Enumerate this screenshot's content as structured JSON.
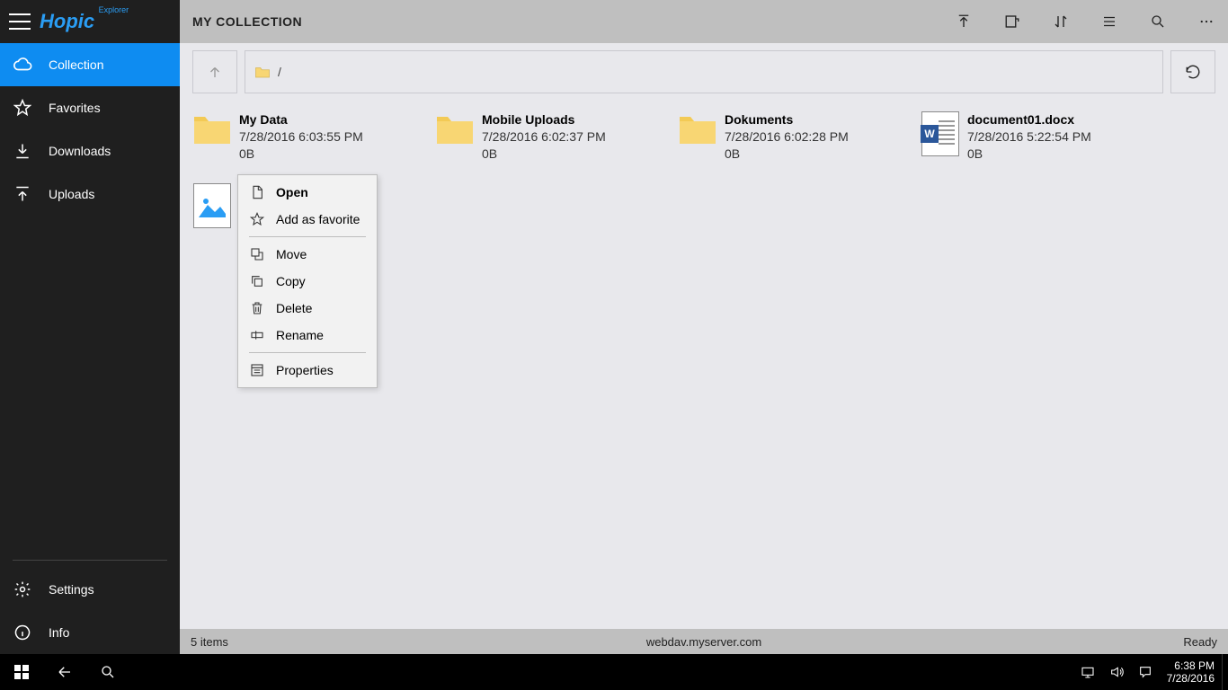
{
  "brand": {
    "name": "Hopic",
    "tag": "Explorer"
  },
  "sidebar": {
    "items": [
      {
        "label": "Collection"
      },
      {
        "label": "Favorites"
      },
      {
        "label": "Downloads"
      },
      {
        "label": "Uploads"
      }
    ],
    "footer": [
      {
        "label": "Settings"
      },
      {
        "label": "Info"
      }
    ]
  },
  "topbar": {
    "title": "MY COLLECTION"
  },
  "pathbar": {
    "path": "/"
  },
  "items": [
    {
      "name": "My Data",
      "date": "7/28/2016 6:03:55 PM",
      "size": "0B",
      "kind": "folder"
    },
    {
      "name": "Mobile Uploads",
      "date": "7/28/2016 6:02:37 PM",
      "size": "0B",
      "kind": "folder"
    },
    {
      "name": "Dokuments",
      "date": "7/28/2016 6:02:28 PM",
      "size": "0B",
      "kind": "folder"
    },
    {
      "name": "document01.docx",
      "date": "7/28/2016 5:22:54 PM",
      "size": "0B",
      "kind": "docx"
    },
    {
      "name": "",
      "date": "",
      "size": "",
      "kind": "image"
    }
  ],
  "context_menu": {
    "open": "Open",
    "favorite": "Add as favorite",
    "move": "Move",
    "copy": "Copy",
    "delete": "Delete",
    "rename": "Rename",
    "properties": "Properties"
  },
  "statusbar": {
    "count": "5 items",
    "host": "webdav.myserver.com",
    "state": "Ready"
  },
  "taskbar": {
    "time": "6:38 PM",
    "date": "7/28/2016"
  }
}
